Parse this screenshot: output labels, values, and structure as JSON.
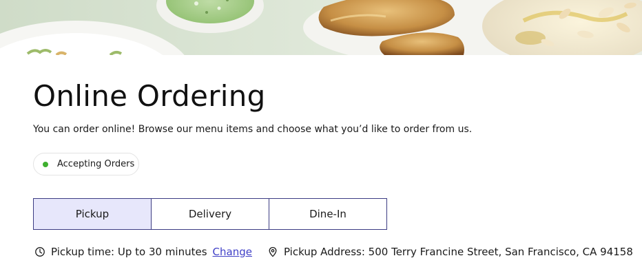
{
  "page": {
    "title": "Online Ordering",
    "subtitle": "You can order online! Browse our menu items and choose what you’d like to order from us."
  },
  "status": {
    "label": "Accepting Orders",
    "color": "#3fb02f"
  },
  "order_types": {
    "selected": "Pickup",
    "tabs": [
      {
        "label": "Pickup",
        "active": true
      },
      {
        "label": "Delivery",
        "active": false
      },
      {
        "label": "Dine-In",
        "active": false
      }
    ]
  },
  "pickup": {
    "time_icon": "clock-icon",
    "time_text": "Pickup time: Up to 30 minutes",
    "change_label": "Change",
    "address_icon": "map-pin-icon",
    "address_text": "Pickup Address: 500 Terry Francine Street, San Francisco, CA 94158"
  },
  "colors": {
    "accent": "#3b3b82",
    "active_tab_bg": "#e7e7fb",
    "link": "#3f3fc7"
  }
}
